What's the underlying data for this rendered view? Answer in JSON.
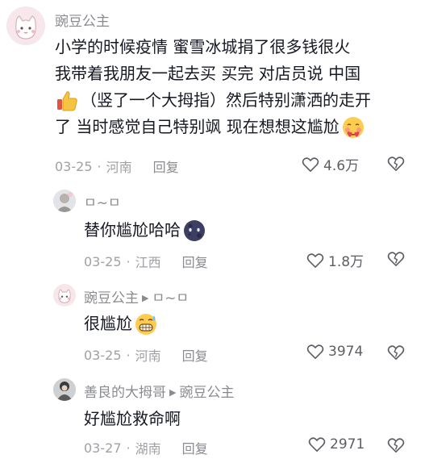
{
  "comments": [
    {
      "username": "豌豆公主",
      "reply_to": "",
      "text_lines": [
        "小学的时候疫情 蜜雪冰城捐了很多钱很火",
        "我带着我朋友一起去买 买完 对店员说 中国",
        "（竖了一个大拇指）然后特别潇洒的走开",
        "了 当时感觉自己特别飒 现在想想这尴尬"
      ],
      "date": "03-25",
      "location": "河南",
      "reply_label": "回复",
      "likes": "4.6万"
    },
    {
      "username": "ㅁ~ㅁ",
      "reply_to": "",
      "text": "替你尴尬哈哈",
      "date": "03-25",
      "location": "江西",
      "reply_label": "回复",
      "likes": "1.8万"
    },
    {
      "username": "豌豆公主",
      "reply_to": "ㅁ~ㅁ",
      "text": "很尴尬",
      "date": "03-25",
      "location": "河南",
      "reply_label": "回复",
      "likes": "3974"
    },
    {
      "username": "善良的大拇哥",
      "reply_to": "豌豆公主",
      "text": "好尴尬救命啊",
      "date": "03-27",
      "location": "湖南",
      "reply_label": "回复",
      "likes": "2971"
    }
  ],
  "icons": {
    "heart": "heart-icon",
    "dislike": "broken-heart-icon",
    "thumbs_up": "thumbs-up-emoji",
    "blush": "blushing-face-emoji",
    "moon": "dark-moon-emoji",
    "grimace": "grimacing-sweat-emoji"
  }
}
